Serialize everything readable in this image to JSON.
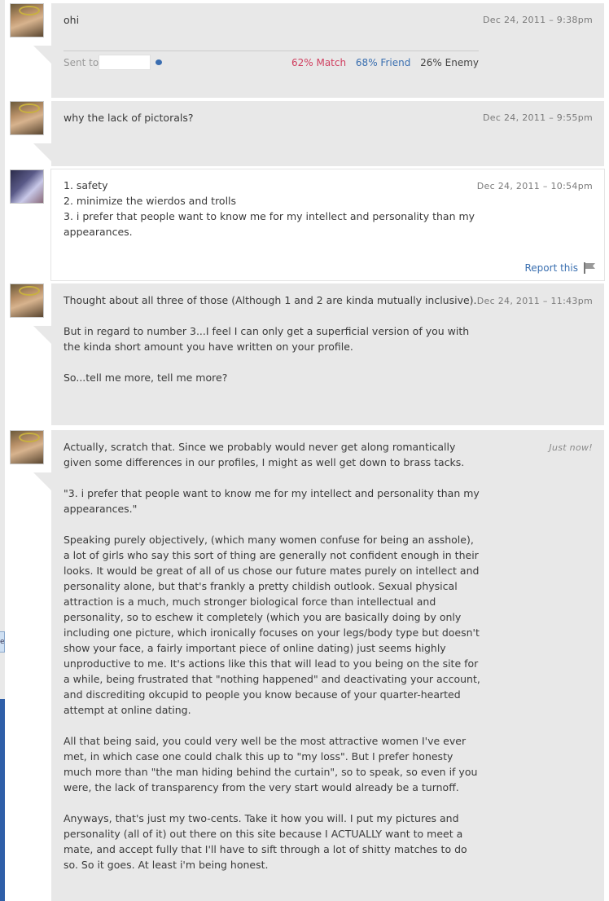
{
  "messages": [
    {
      "author": "other",
      "date": "Dec 24, 2011 – 9:38pm",
      "paragraphs": [
        "ohi"
      ],
      "sent_to_label": "Sent to",
      "match": "62% Match",
      "friend": "68% Friend",
      "enemy": "26% Enemy"
    },
    {
      "author": "other",
      "date": "Dec 24, 2011 – 9:55pm",
      "paragraphs": [
        "why the lack of pictorals?"
      ]
    },
    {
      "author": "self",
      "date": "Dec 24, 2011 – 10:54pm",
      "lines": [
        "1. safety",
        "2. minimize the wierdos and trolls",
        "3. i prefer that people want to know me for my intellect and personality than my appearances."
      ],
      "report_label": "Report this"
    },
    {
      "author": "other",
      "date": "Dec 24, 2011 – 11:43pm",
      "paragraphs": [
        "Thought about all three of those (Although 1 and 2 are kinda mutually inclusive).",
        "But in regard to number 3...I feel I can only get a superficial version of you with the kinda short amount you have written on your profile.",
        "So...tell me more, tell me more?"
      ]
    },
    {
      "author": "other",
      "date": "Just now!",
      "paragraphs": [
        "Actually, scratch that. Since we probably would never get along romantically given some differences in our profiles, I might as well get down to brass tacks.",
        "\"3. i prefer that people want to know me for my intellect and personality than my appearances.\"",
        "Speaking purely objectively, (which many women confuse for being an asshole), a lot of girls who say this sort of thing are generally not confident enough in their looks. It would be great of all of us chose our future mates purely on intellect and personality alone, but that's frankly a pretty childish outlook. Sexual physical attraction is a much, much stronger biological force than intellectual and personality, so to eschew it completely (which you are basically doing by only including one picture, which ironically focuses on your legs/body type but doesn't show your face, a fairly important piece of online dating) just seems highly unproductive to me. It's actions like this that will lead to you being on the site for a while, being frustrated that \"nothing happened\" and deactivating your account, and discrediting okcupid to people you know because of your quarter-hearted attempt at online dating.",
        "All that being said, you could very well be the most attractive women I've ever met, in which case one could chalk this up to \"my loss\". But I prefer honesty much more than \"the man hiding behind the curtain\", so to speak, so even if you were, the lack of transparency from the very start would already be a turnoff.",
        "Anyways, that's just my two-cents. Take it how you will. I put my pictures and personality (all of it) out there on this site because I ACTUALLY want to meet a mate, and accept fully that I'll have to sift through a lot of shitty matches to do so. So it goes. At least i'm being honest."
      ]
    }
  ],
  "side_tab_text": "e"
}
